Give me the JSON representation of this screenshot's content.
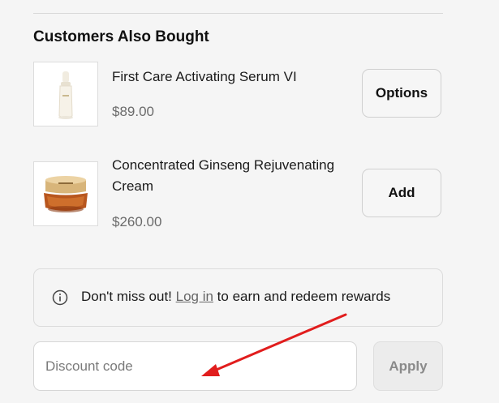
{
  "section": {
    "title": "Customers Also Bought"
  },
  "products": [
    {
      "name": "First Care Activating Serum VI",
      "price": "$89.00",
      "button_label": "Options",
      "image_icon": "serum-bottle-icon"
    },
    {
      "name": "Concentrated Ginseng Rejuvenating Cream",
      "price": "$260.00",
      "button_label": "Add",
      "image_icon": "cream-jar-icon"
    }
  ],
  "rewards_notice": {
    "icon": "info-icon",
    "prefix": "Don't miss out! ",
    "link_text": "Log in",
    "suffix": " to earn and redeem rewards"
  },
  "discount": {
    "placeholder": "Discount code",
    "value": "",
    "apply_label": "Apply"
  },
  "colors": {
    "background": "#f5f5f5",
    "annotation_arrow": "#e11d1d",
    "price_text": "#6b6b6b"
  }
}
